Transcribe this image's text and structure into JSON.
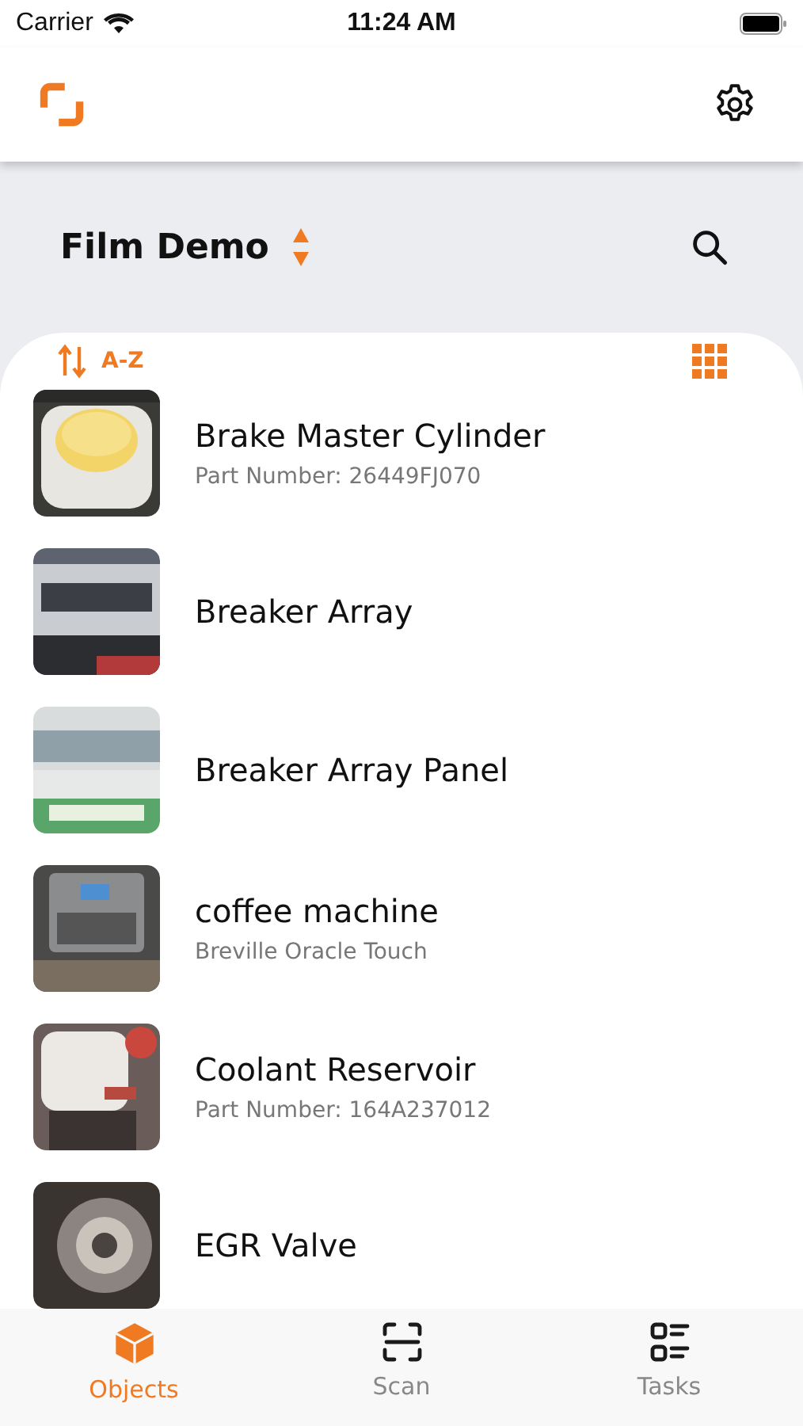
{
  "status_bar": {
    "carrier": "Carrier",
    "time": "11:24 AM"
  },
  "workspace": {
    "title": "Film Demo"
  },
  "sort": {
    "label": "A-Z"
  },
  "objects": [
    {
      "name": "Brake Master Cylinder",
      "subtitle": "Part Number: 26449FJ070"
    },
    {
      "name": "Breaker Array"
    },
    {
      "name": "Breaker Array Panel"
    },
    {
      "name": "coffee machine",
      "subtitle": "Breville Oracle Touch"
    },
    {
      "name": "Coolant Reservoir",
      "subtitle": "Part Number: 164A237012"
    },
    {
      "name": "EGR Valve"
    }
  ],
  "tabs": [
    {
      "label": "Objects",
      "kind": "objects",
      "selected": true
    },
    {
      "label": "Scan",
      "kind": "scan",
      "selected": false
    },
    {
      "label": "Tasks",
      "kind": "tasks",
      "selected": false
    }
  ]
}
